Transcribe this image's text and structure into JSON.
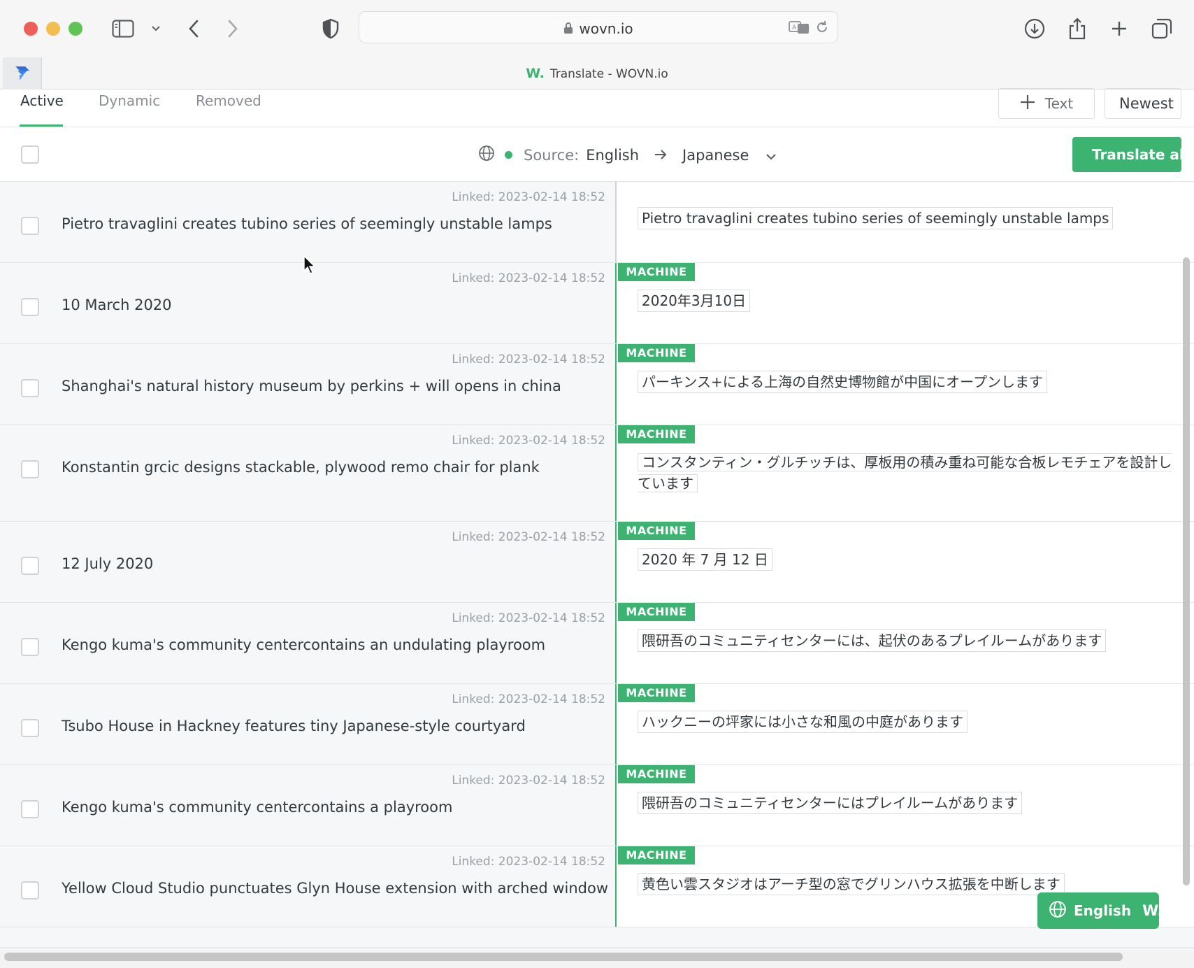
{
  "browser": {
    "url": "wovn.io",
    "tab_title": "Translate - WOVN.io",
    "tab_logo": "W."
  },
  "toolbar": {
    "tabs": [
      {
        "label": "Active"
      },
      {
        "label": "Dynamic"
      },
      {
        "label": "Removed"
      }
    ],
    "add_text_label": "Text",
    "sort_label": "Newest"
  },
  "language_bar": {
    "source_prefix": "Source:",
    "source_language": "English",
    "target_language": "Japanese",
    "translate_all_label": "Translate all"
  },
  "rows": [
    {
      "source": "Pietro travaglini creates tubino series of seemingly unstable lamps",
      "linked": "Linked: 2023-02-14 18:52",
      "badge": "",
      "translation": "Pietro travaglini creates tubino series of seemingly unstable lamps"
    },
    {
      "source": "10 March 2020",
      "linked": "Linked: 2023-02-14 18:52",
      "badge": "MACHINE",
      "translation": "2020年3月10日"
    },
    {
      "source": "Shanghai's natural history museum by perkins + will opens in china",
      "linked": "Linked: 2023-02-14 18:52",
      "badge": "MACHINE",
      "translation": "パーキンス+による上海の自然史博物館が中国にオープンします"
    },
    {
      "source": "Konstantin grcic designs stackable, plywood remo chair for plank",
      "linked": "Linked: 2023-02-14 18:52",
      "badge": "MACHINE",
      "translation": "コンスタンティン・グルチッチは、厚板用の積み重ね可能な合板レモチェアを設計しています"
    },
    {
      "source": "12 July 2020",
      "linked": "Linked: 2023-02-14 18:52",
      "badge": "MACHINE",
      "translation": "2020 年 7 月 12 日"
    },
    {
      "source": "Kengo kuma's community centercontains an undulating playroom",
      "linked": "Linked: 2023-02-14 18:52",
      "badge": "MACHINE",
      "translation": "隈研吾のコミュニティセンターには、起伏のあるプレイルームがあります"
    },
    {
      "source": "Tsubo House in Hackney features tiny Japanese-style courtyard",
      "linked": "Linked: 2023-02-14 18:52",
      "badge": "MACHINE",
      "translation": "ハックニーの坪家には小さな和風の中庭があります"
    },
    {
      "source": "Kengo kuma's community centercontains a playroom",
      "linked": "Linked: 2023-02-14 18:52",
      "badge": "MACHINE",
      "translation": "隈研吾のコミュニティセンターにはプレイルームがあります"
    },
    {
      "source": "Yellow Cloud Studio punctuates Glyn House extension with arched window",
      "linked": "Linked: 2023-02-14 18:52",
      "badge": "MACHINE",
      "translation": "黄色い雲スタジオはアーチ型の窓でグリンハウス拡張を中断します"
    }
  ],
  "widget": {
    "language_label": "English",
    "logo": "W."
  },
  "colors": {
    "accent": "#3cb371",
    "row_background": "#f6f7f8"
  }
}
